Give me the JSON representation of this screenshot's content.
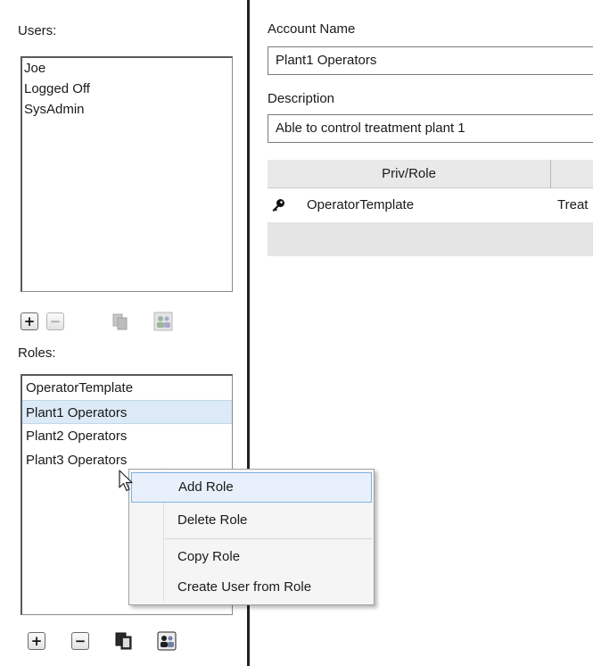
{
  "users": {
    "label": "Users:",
    "items": [
      "Joe",
      "Logged Off",
      "SysAdmin"
    ],
    "toolbar": [
      "add-icon",
      "remove-icon",
      "copy-icon",
      "create-user-icon"
    ]
  },
  "roles": {
    "label": "Roles:",
    "items": [
      "OperatorTemplate",
      "Plant1 Operators",
      "Plant2 Operators",
      "Plant3 Operators"
    ],
    "selected_index": 1,
    "toolbar": [
      "add-icon",
      "remove-icon",
      "copy-icon",
      "create-user-icon"
    ]
  },
  "account": {
    "name_label": "Account Name",
    "name_value": "Plant1 Operators",
    "description_label": "Description",
    "description_value": "Able to control treatment plant 1"
  },
  "grid": {
    "header": "Priv/Role",
    "rows": [
      {
        "icon": "key-icon",
        "name": "OperatorTemplate",
        "second_col": "Treat"
      }
    ]
  },
  "context_menu": {
    "items": [
      "Add Role",
      "Delete Role",
      "Copy Role",
      "Create User from Role"
    ],
    "hover_index": 0
  },
  "colors": {
    "selection": "#dbeaf6",
    "menu_hover_border": "#7fb0e0",
    "splitter": "#222222"
  }
}
